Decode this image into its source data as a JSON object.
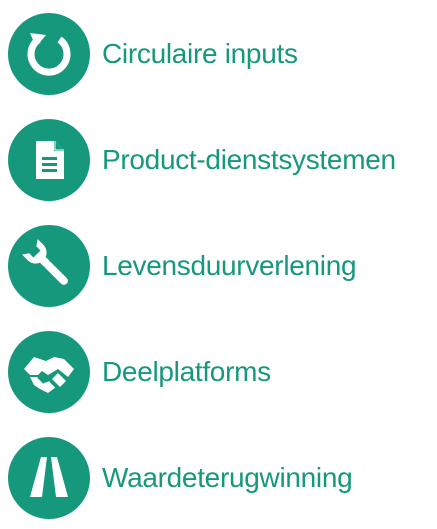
{
  "accent_color": "#16987d",
  "items": [
    {
      "label": "Circulaire inputs",
      "icon": "circular-arrow-icon"
    },
    {
      "label": "Product-dienstsystemen",
      "icon": "document-icon"
    },
    {
      "label": "Levensduurverlening",
      "icon": "wrench-icon"
    },
    {
      "label": "Deelplatforms",
      "icon": "handshake-icon"
    },
    {
      "label": "Waardeterugwinning",
      "icon": "road-icon"
    }
  ]
}
